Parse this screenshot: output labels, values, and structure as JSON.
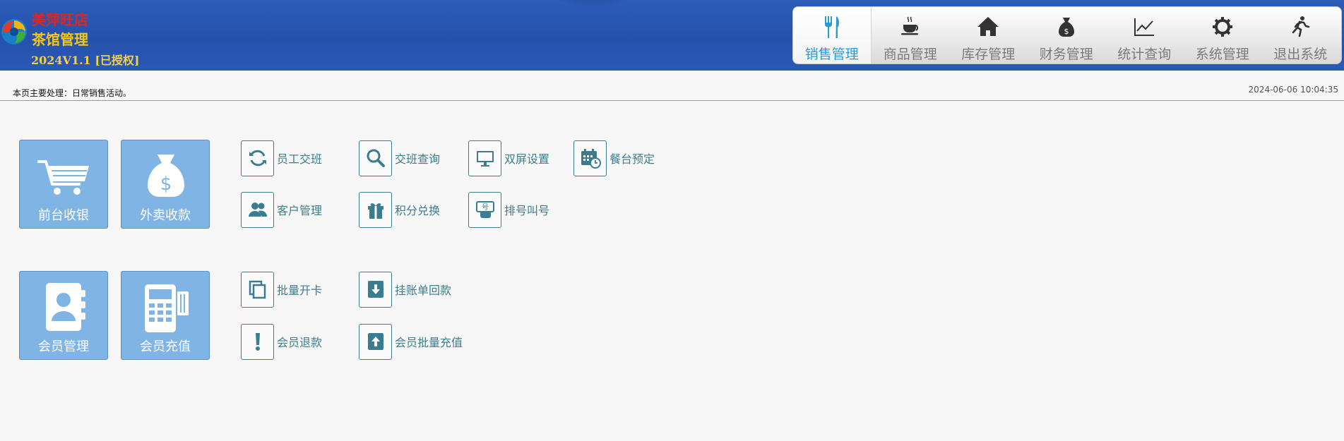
{
  "brand": {
    "line1": "美萍旺店",
    "line2": "茶馆管理",
    "version": "2024V1.1 [已授权]"
  },
  "topnav": {
    "items": [
      {
        "label": "销售管理",
        "icon": "utensils-icon",
        "active": true
      },
      {
        "label": "商品管理",
        "icon": "coffee-cup-icon",
        "active": false
      },
      {
        "label": "库存管理",
        "icon": "home-icon",
        "active": false
      },
      {
        "label": "财务管理",
        "icon": "money-bag-icon",
        "active": false
      },
      {
        "label": "统计查询",
        "icon": "line-chart-icon",
        "active": false
      },
      {
        "label": "系统管理",
        "icon": "gear-icon",
        "active": false
      },
      {
        "label": "退出系统",
        "icon": "running-man-icon",
        "active": false
      }
    ]
  },
  "info": {
    "description": "本页主要处理：日常销售活动。",
    "datetime": "2024-06-06 10:04:35"
  },
  "tiles": [
    {
      "label": "前台收银",
      "icon": "shopping-cart-icon"
    },
    {
      "label": "外卖收款",
      "icon": "money-bag-icon"
    },
    {
      "label": "会员管理",
      "icon": "member-book-icon"
    },
    {
      "label": "会员充值",
      "icon": "pos-terminal-icon"
    }
  ],
  "shortcuts": [
    {
      "label": "员工交班",
      "icon": "refresh-icon"
    },
    {
      "label": "交班查询",
      "icon": "search-icon"
    },
    {
      "label": "双屏设置",
      "icon": "monitor-icon"
    },
    {
      "label": "餐台预定",
      "icon": "calendar-clock-icon"
    },
    {
      "label": "客户管理",
      "icon": "users-icon"
    },
    {
      "label": "积分兑换",
      "icon": "gift-icon"
    },
    {
      "label": "排号叫号",
      "icon": "queue-ticket-icon"
    },
    {
      "label": "批量开卡",
      "icon": "copy-icon"
    },
    {
      "label": "挂账单回款",
      "icon": "download-icon"
    },
    {
      "label": "会员退款",
      "icon": "exclamation-icon"
    },
    {
      "label": "会员批量充值",
      "icon": "upload-icon"
    }
  ],
  "colors": {
    "header_blue": "#2452ad",
    "tile_blue": "#7fb4e5",
    "shortcut_teal": "#3b7d8f",
    "active_nav": "#2a9bd6"
  }
}
